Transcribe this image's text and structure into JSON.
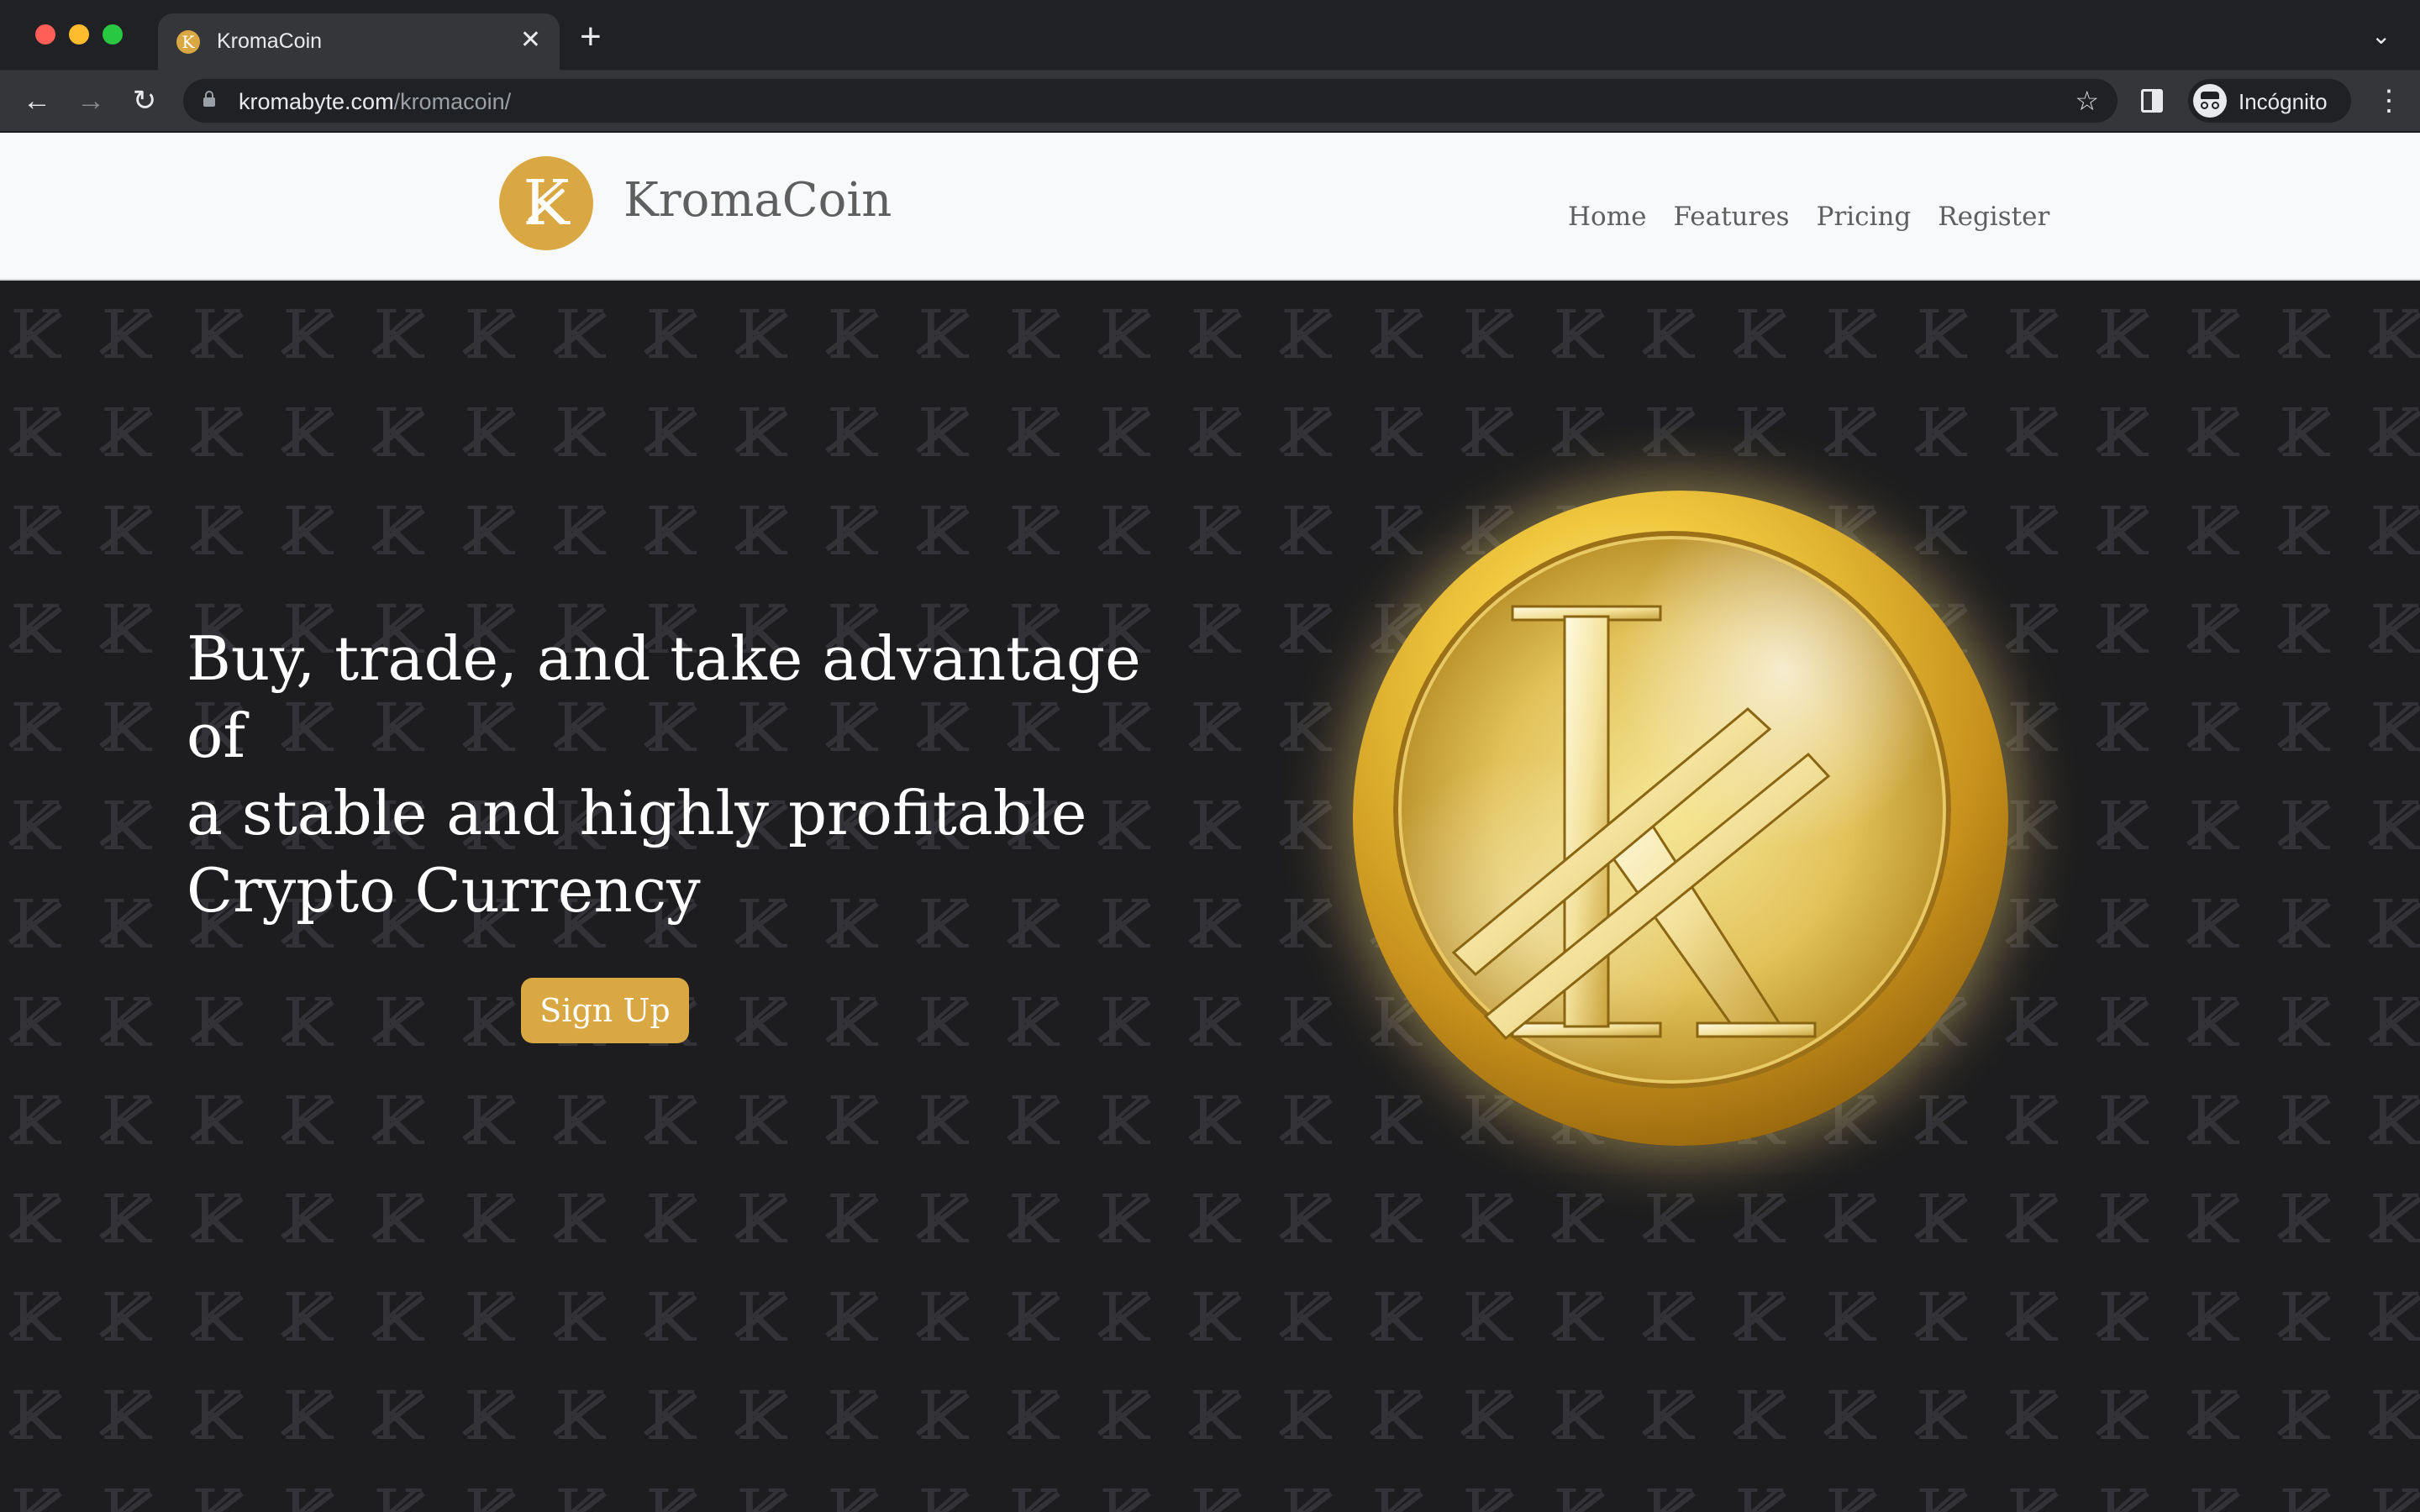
{
  "browser": {
    "tab_title": "KromaCoin",
    "tab_favicon_letter": "K",
    "url_host": "kromabyte.com",
    "url_path": "/kromacoin/",
    "profile_label": "Incógnito",
    "icons": [
      "back-arrow-icon",
      "forward-arrow-icon",
      "reload-icon",
      "lock-icon",
      "star-icon",
      "side-panel-icon",
      "incognito-icon",
      "kebab-menu-icon",
      "close-icon",
      "plus-icon",
      "chevron-down-icon"
    ]
  },
  "site": {
    "brand": "KromaCoin",
    "logo_letter": "K",
    "nav": [
      "Home",
      "Features",
      "Pricing",
      "Register"
    ],
    "accent_color": "#d9a843"
  },
  "hero": {
    "headline_lines": [
      "Buy, trade, and take advantage of",
      "a stable and highly profitable",
      "Crypto Currency"
    ],
    "cta_label": "Sign Up",
    "background_color": "#1d1d1f",
    "coin_letter": "K"
  }
}
